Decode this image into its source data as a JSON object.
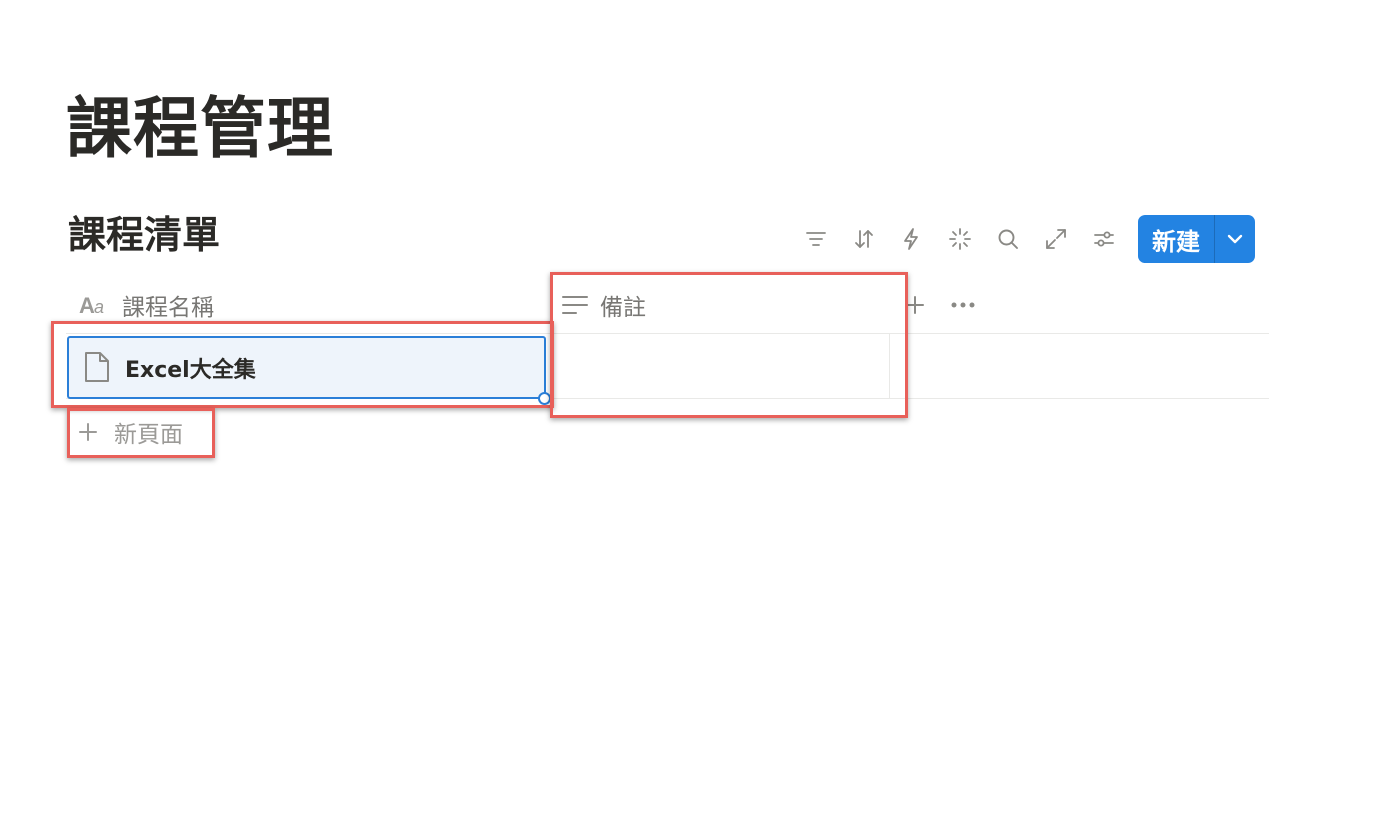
{
  "page": {
    "title": "課程管理"
  },
  "database": {
    "title": "課程清單",
    "toolbar": {
      "icons": [
        "filter-icon",
        "sort-icon",
        "automation-icon",
        "ai-sparkle-icon",
        "search-icon",
        "expand-icon",
        "settings-icon"
      ],
      "new_button_label": "新建",
      "accent_color": "#2383e2"
    },
    "columns": [
      {
        "label": "課程名稱",
        "icon": "title-aa-icon"
      },
      {
        "label": "備註",
        "icon": "text-lines-icon"
      }
    ],
    "rows": [
      {
        "name": "Excel大全集",
        "note": ""
      }
    ],
    "new_page_label": "新頁面"
  },
  "annotation_color": "#e8605a"
}
